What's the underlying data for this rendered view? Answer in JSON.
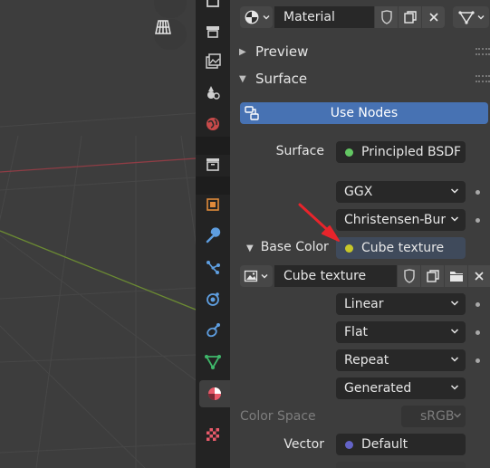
{
  "viewport": {
    "buttons": [
      {
        "icon": "camera-icon"
      },
      {
        "icon": "grid-icon"
      }
    ]
  },
  "tabs": [
    {
      "icon": "tool-icon"
    },
    {
      "icon": "render-icon"
    },
    {
      "icon": "output-icon"
    },
    {
      "icon": "view-layer-icon"
    },
    {
      "icon": "scene-icon"
    },
    {
      "icon": "world-icon"
    },
    {
      "icon": "collection-icon"
    },
    {
      "icon": "object-icon"
    },
    {
      "icon": "modifier-icon"
    },
    {
      "icon": "particles-icon"
    },
    {
      "icon": "physics-icon"
    },
    {
      "icon": "constraints-icon"
    },
    {
      "icon": "data-icon"
    },
    {
      "icon": "material-icon",
      "active": true
    },
    {
      "icon": "texture-icon"
    }
  ],
  "header": {
    "material_name": "Material"
  },
  "panels": {
    "preview": "Preview",
    "surface": "Surface"
  },
  "use_nodes_label": "Use Nodes",
  "surface": {
    "label": "Surface",
    "value": "Principled BSDF",
    "socket_color": "#63c763"
  },
  "distribution": "GGX",
  "subsurface_method": "Christensen-Burle",
  "base_color": {
    "label": "Base Color",
    "value": "Cube texture",
    "socket_color": "#c7c729"
  },
  "texture": {
    "name": "Cube texture",
    "interpolation": "Linear",
    "projection": "Flat",
    "extension": "Repeat",
    "source": "Generated",
    "color_space_label": "Color Space",
    "color_space_value": "sRGB"
  },
  "vector": {
    "label": "Vector",
    "value": "Default",
    "socket_color": "#6363c7"
  },
  "colors": {
    "accent": "#4772b3",
    "annotation_arrow": "#e8242b",
    "axis_x": "#a8474f",
    "axis_y": "#7a9a3a"
  }
}
